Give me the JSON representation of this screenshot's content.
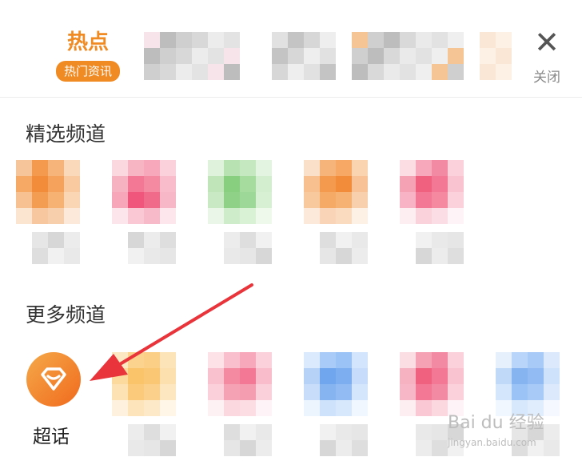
{
  "header": {
    "hot_title": "热点",
    "hot_badge": "热门资讯",
    "close_label": "关闭",
    "close_glyph": "✕",
    "accent": "#f08a22"
  },
  "sections": {
    "featured_title": "精选频道",
    "more_title": "更多频道"
  },
  "featured_tiles": [
    {
      "icon": "orange-pixelated-icon",
      "colors": [
        "#f6c59a",
        "#f39a4f",
        "#f6b37a",
        "#fad9bb",
        "#f6a964",
        "#f28c3a",
        "#f5a35c",
        "#f9caa0",
        "#f8c192",
        "#f39d52",
        "#f6b272",
        "#fbd6b4",
        "#fbe4d0",
        "#f7c7a0",
        "#f8cfad",
        "#fde9d9"
      ]
    },
    {
      "icon": "pink-pixelated-icon",
      "colors": [
        "#fbd7e0",
        "#f7b5c4",
        "#f7a9bb",
        "#fbd1dc",
        "#f7b2c2",
        "#f27896",
        "#f38aa2",
        "#f8bccb",
        "#f6a6b8",
        "#f0567b",
        "#f06a8a",
        "#f7b7c6",
        "#fce6ec",
        "#f9c8d4",
        "#f7bac9",
        "#fde6ec"
      ]
    },
    {
      "icon": "green-pixelated-icon",
      "colors": [
        "#dff2dc",
        "#b9e2b3",
        "#c5e8c0",
        "#e3f4e0",
        "#bfe5b9",
        "#88cf7f",
        "#a6dc9e",
        "#d3eecf",
        "#c8e9c3",
        "#8fd287",
        "#9ed898",
        "#d7f0d3",
        "#eaf7e8",
        "#cfecca",
        "#d9f1d5",
        "#eef9ec"
      ]
    },
    {
      "icon": "orange-pixelated-icon-2",
      "colors": [
        "#fbe0c9",
        "#f7b47a",
        "#f6a864",
        "#fad3b1",
        "#f8c08f",
        "#f39a4f",
        "#f28c3a",
        "#f8c296",
        "#f9c99e",
        "#f5aa66",
        "#f6b272",
        "#f9d0ad",
        "#fde9d9",
        "#f9d4b6",
        "#fadbbf",
        "#fdf0e4"
      ]
    },
    {
      "icon": "rose-pixelated-icon",
      "colors": [
        "#fcdde4",
        "#f7a9bb",
        "#f28aa3",
        "#fbd1dc",
        "#f6a2b5",
        "#f0607f",
        "#f27896",
        "#f9c3d0",
        "#f8b4c4",
        "#f27896",
        "#f4899f",
        "#fbd1dc",
        "#fdeef2",
        "#fad2dc",
        "#fbdde5",
        "#fef3f6"
      ]
    }
  ],
  "more_tiles": [
    {
      "label": "超话",
      "icon": "chaohua-diamond-icon"
    },
    {
      "icon": "yellow-pixelated-icon",
      "colors": [
        "#fde8c4",
        "#fbd38e",
        "#fbcf85",
        "#fde3b8",
        "#fcd99d",
        "#f9c46a",
        "#fac774",
        "#fce0ae",
        "#fde2b4",
        "#fbcb7b",
        "#fbd08a",
        "#fde7c1",
        "#fef2de",
        "#fde4bb",
        "#fde9c8",
        "#fff6e8"
      ]
    },
    {
      "icon": "pink-pixelated-icon-2",
      "colors": [
        "#fde2e8",
        "#f9bfcc",
        "#f7a9bb",
        "#fbd1dc",
        "#f9c0cd",
        "#f38aa2",
        "#f27896",
        "#f8bccb",
        "#fbd0da",
        "#f6a2b5",
        "#f49cb0",
        "#fad0da",
        "#fef1f4",
        "#fbd7e0",
        "#fcdde4",
        "#fef3f6"
      ]
    },
    {
      "icon": "blue-pixelated-icon",
      "colors": [
        "#dceafd",
        "#a9cbf7",
        "#9cc3f5",
        "#d3e5fc",
        "#b6d2f7",
        "#6fa6ee",
        "#7daff0",
        "#c6dcfa",
        "#c8ddfa",
        "#86b4f0",
        "#91bbf2",
        "#d4e6fc",
        "#ecf4fe",
        "#cfe2fb",
        "#d8e8fc",
        "#f1f7fe"
      ]
    },
    {
      "icon": "red-pixelated-icon",
      "colors": [
        "#fbdde4",
        "#f6a2b5",
        "#f28aa3",
        "#fbd1dc",
        "#f7b2c2",
        "#f0607f",
        "#f27896",
        "#f9c3d0",
        "#f8b7c6",
        "#f27896",
        "#f28aa3",
        "#fbd1dc",
        "#fdeef2",
        "#f9c8d4",
        "#fbd7e0",
        "#fef3f6"
      ]
    },
    {
      "icon": "light-blue-pixelated-icon",
      "colors": [
        "#e6f0fd",
        "#b9d5f9",
        "#a7caf7",
        "#dce9fc",
        "#c0d9f9",
        "#86b4f0",
        "#91bbf2",
        "#cfe2fb",
        "#d4e6fc",
        "#9cc3f5",
        "#a7caf7",
        "#dce9fc",
        "#f1f7fe",
        "#d8e8fc",
        "#e0edfd",
        "#f5f9ff"
      ]
    }
  ],
  "watermark": {
    "brand": "Bai du 经验",
    "url": "jingyan.baidu.com"
  }
}
